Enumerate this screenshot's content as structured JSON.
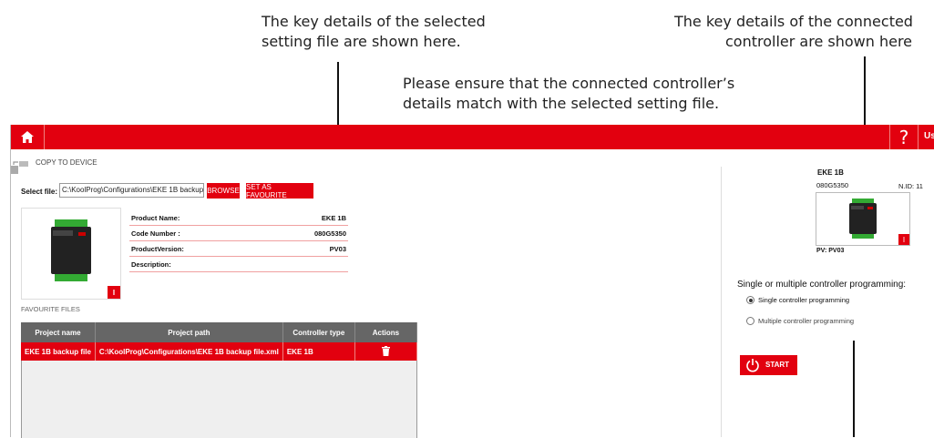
{
  "annotations": {
    "selected_file_line1": "The key details of the selected",
    "selected_file_line2": "setting file are shown here.",
    "controller_line1": "The key details of the connected",
    "controller_line2": "controller are shown here",
    "match_line1": "Please ensure that the connected controller’s",
    "match_line2": "details match with the selected setting file."
  },
  "topbar": {
    "help_label": "?",
    "user_label": "Use",
    "icons": [
      "home-icon"
    ]
  },
  "page": {
    "title": "COPY TO DEVICE"
  },
  "file_select": {
    "label": "Select file:",
    "value": "C:\\KoolProg\\Configurations\\EKE 1B backup",
    "browse_label": "BROWSE",
    "favourite_label": "SET AS FAVOURITE"
  },
  "details": {
    "rows": [
      {
        "label": "Product Name:",
        "value": "EKE 1B"
      },
      {
        "label": "Code Number :",
        "value": "080G5350"
      },
      {
        "label": "ProductVersion:",
        "value": "PV03"
      },
      {
        "label": "Description:",
        "value": ""
      }
    ],
    "info_label": "i"
  },
  "favourites": {
    "section_label": "FAVOURITE FILES",
    "columns": [
      "Project name",
      "Project path",
      "Controller type",
      "Actions"
    ],
    "rows": [
      {
        "name": "EKE 1B backup file",
        "path": "C:\\KoolProg\\Configurations\\EKE 1B backup file.xml",
        "type": "EKE 1B",
        "action_icon": "trash-icon"
      }
    ]
  },
  "controller": {
    "name": "EKE 1B",
    "code": "080G5350",
    "nid": "N.ID: 11",
    "pv": "PV: PV03",
    "info_label": "i"
  },
  "programming": {
    "heading": "Single or multiple controller programming:",
    "options": [
      {
        "label": "Single controller programming",
        "checked": true
      },
      {
        "label": "Multiple controller programming",
        "checked": false
      }
    ],
    "start_label": "START"
  },
  "colors": {
    "accent": "#e2000f",
    "header_gray": "#666666"
  }
}
